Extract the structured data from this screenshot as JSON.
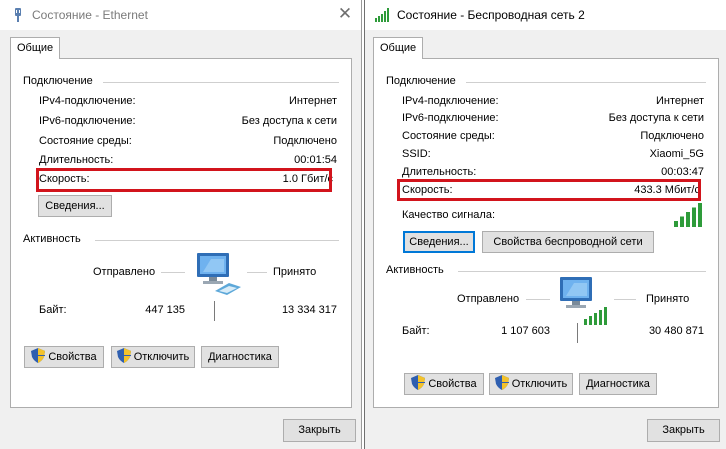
{
  "left": {
    "title": "Состояние - Ethernet",
    "tab": "Общие",
    "connection_group": "Подключение",
    "rows": [
      {
        "label": "IPv4-подключение:",
        "value": "Интернет"
      },
      {
        "label": "IPv6-подключение:",
        "value": "Без доступа к сети"
      },
      {
        "label": "Состояние среды:",
        "value": "Подключено"
      },
      {
        "label": "Длительность:",
        "value": "00:01:54"
      },
      {
        "label": "Скорость:",
        "value": "1.0 Гбит/с"
      }
    ],
    "details_button": "Сведения...",
    "activity_group": "Активность",
    "sent_label": "Отправлено",
    "received_label": "Принято",
    "bytes_label": "Байт:",
    "bytes_sent": "447 135",
    "bytes_received": "13 334 317",
    "properties_button": "Свойства",
    "disable_button": "Отключить",
    "diagnostics_button": "Диагностика",
    "close_button": "Закрыть"
  },
  "right": {
    "title": "Состояние - Беспроводная сеть 2",
    "tab": "Общие",
    "connection_group": "Подключение",
    "rows": [
      {
        "label": "IPv4-подключение:",
        "value": "Интернет"
      },
      {
        "label": "IPv6-подключение:",
        "value": "Без доступа к сети"
      },
      {
        "label": "Состояние среды:",
        "value": "Подключено"
      },
      {
        "label": "SSID:",
        "value": "Xiaomi_5G"
      },
      {
        "label": "Длительность:",
        "value": "00:03:47"
      },
      {
        "label": "Скорость:",
        "value": "433.3 Мбит/с"
      }
    ],
    "signal_label": "Качество сигнала:",
    "signal_bars": 5,
    "details_button": "Сведения...",
    "wireless_props_button": "Свойства беспроводной сети",
    "activity_group": "Активность",
    "sent_label": "Отправлено",
    "received_label": "Принято",
    "bytes_label": "Байт:",
    "bytes_sent": "1 107 603",
    "bytes_received": "30 480 871",
    "properties_button": "Свойства",
    "disable_button": "Отключить",
    "diagnostics_button": "Диагностика",
    "close_button": "Закрыть"
  },
  "colors": {
    "highlight": "#d2141c",
    "signal_green": "#2e9b3a",
    "focus_blue": "#0078d7"
  }
}
